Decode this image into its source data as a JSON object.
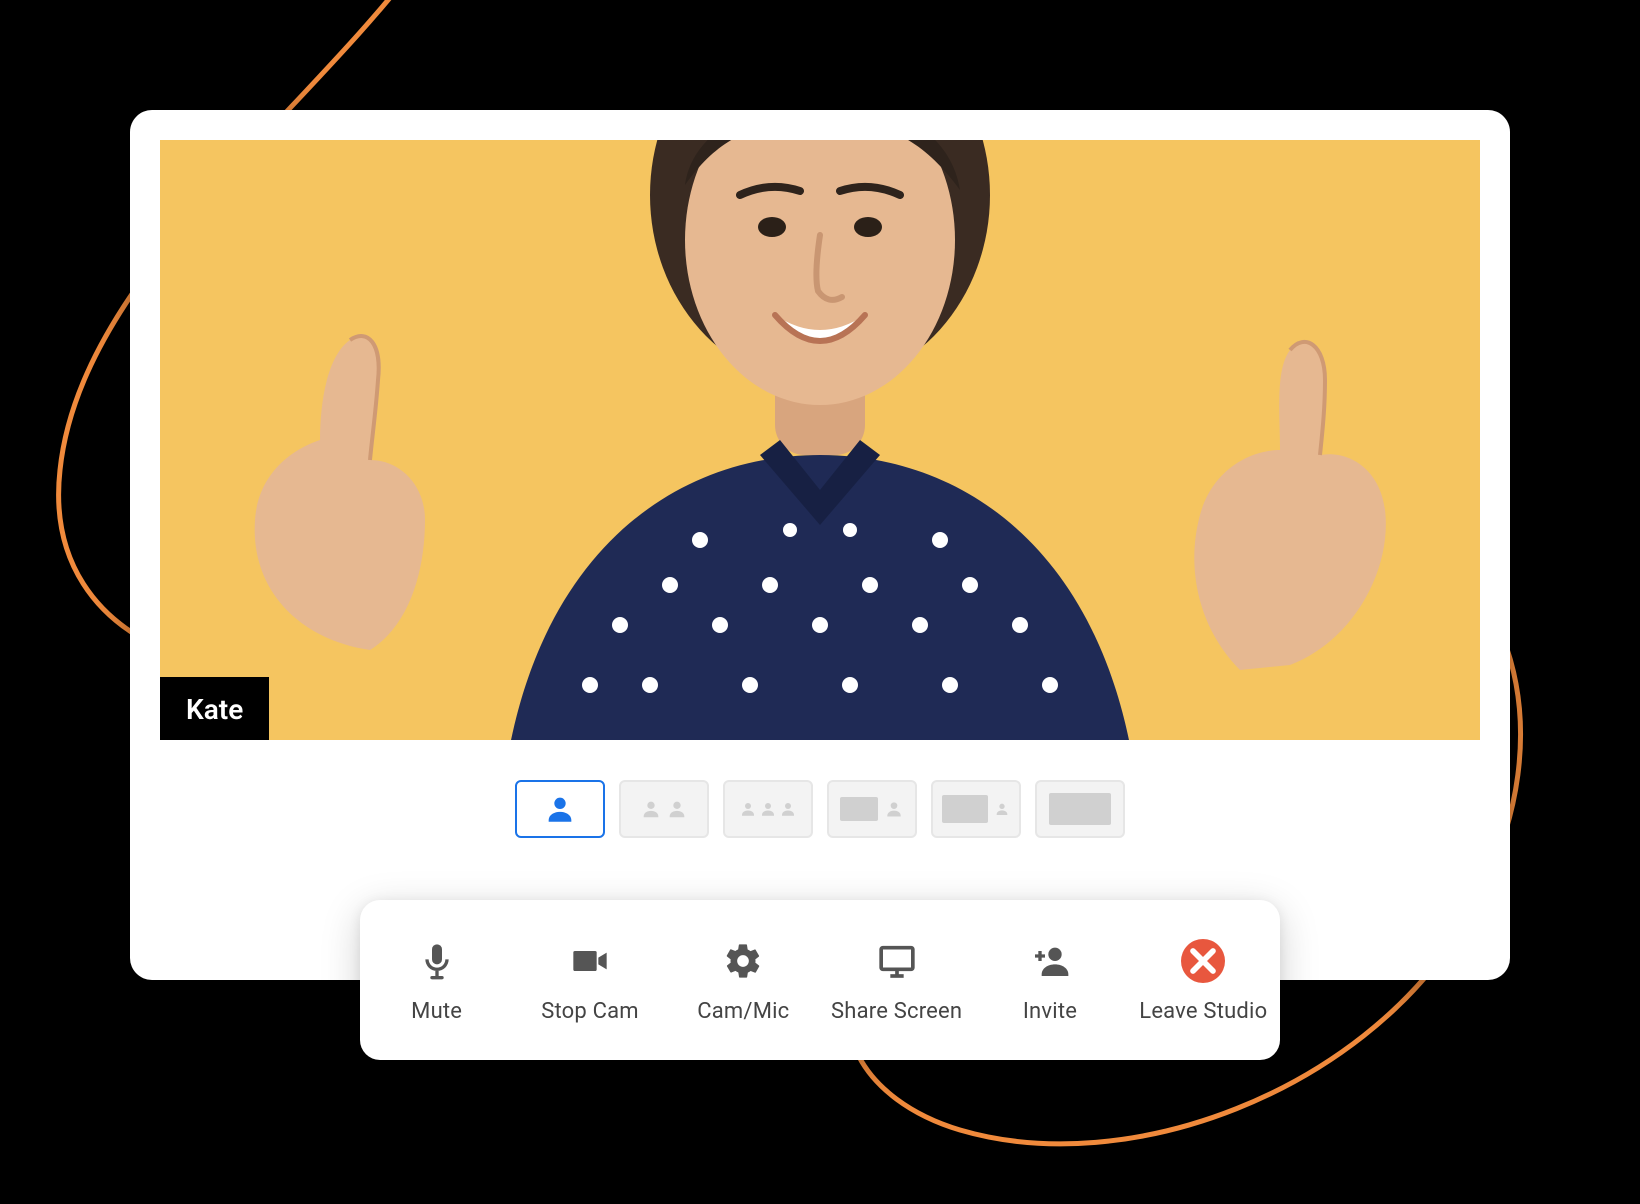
{
  "participant": {
    "name": "Kate"
  },
  "layouts": {
    "options": [
      {
        "id": "solo",
        "active": true
      },
      {
        "id": "two-up",
        "active": false
      },
      {
        "id": "three-up",
        "active": false
      },
      {
        "id": "screen-plus-speaker",
        "active": false
      },
      {
        "id": "screen-large-speaker",
        "active": false
      },
      {
        "id": "screen-only",
        "active": false
      }
    ]
  },
  "controls": {
    "mute": "Mute",
    "stop_cam": "Stop Cam",
    "cam_mic": "Cam/Mic",
    "share_screen": "Share Screen",
    "invite": "Invite",
    "leave": "Leave Studio"
  },
  "colors": {
    "video_bg": "#f5c560",
    "accent": "#1a73e8",
    "leave": "#e8573e",
    "swoosh": "#f08a3c"
  }
}
